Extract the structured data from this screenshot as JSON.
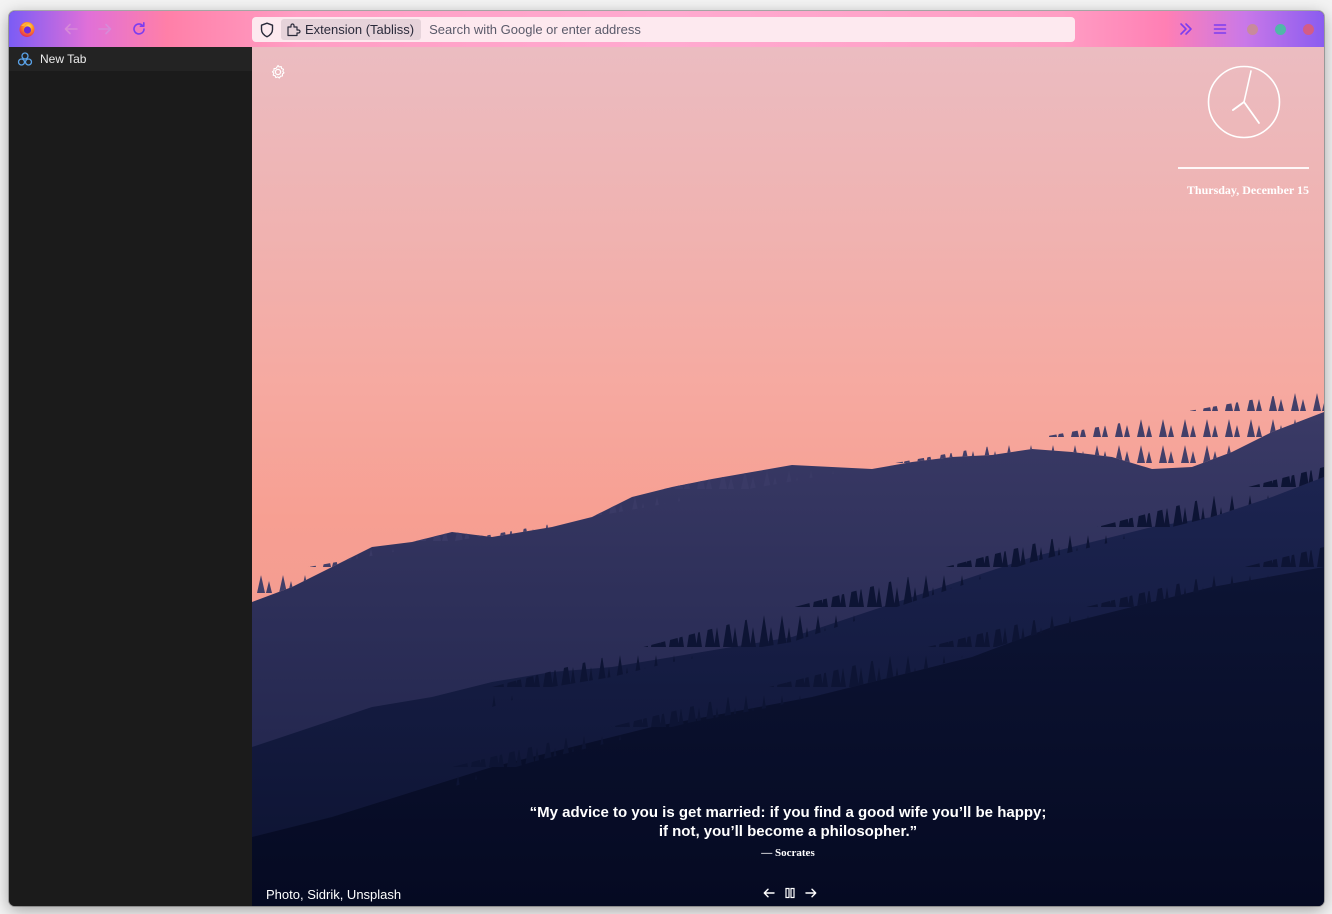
{
  "toolbar": {
    "extension_label": "Extension (Tabliss)",
    "search_placeholder": "Search with Google or enter address",
    "colors": {
      "accent": "#7b3df0",
      "dot1": "#c88a9c",
      "dot2": "#4fb8a8",
      "dot3": "#d45c86"
    }
  },
  "sidebar": {
    "tabs": [
      {
        "label": "New Tab",
        "icon": "tabliss-icon"
      }
    ]
  },
  "dashboard": {
    "date": "Thursday, December 15",
    "quote_line1": "“My advice to you is get married: if you find a good wife you’ll be happy;",
    "quote_line2": "if not, you’ll become a philosopher.”",
    "author": "— Socrates",
    "photo_credit": "Photo, Sidrik, Unsplash",
    "clock_icon": "analog-clock",
    "settings_icon": "gear-icon"
  }
}
